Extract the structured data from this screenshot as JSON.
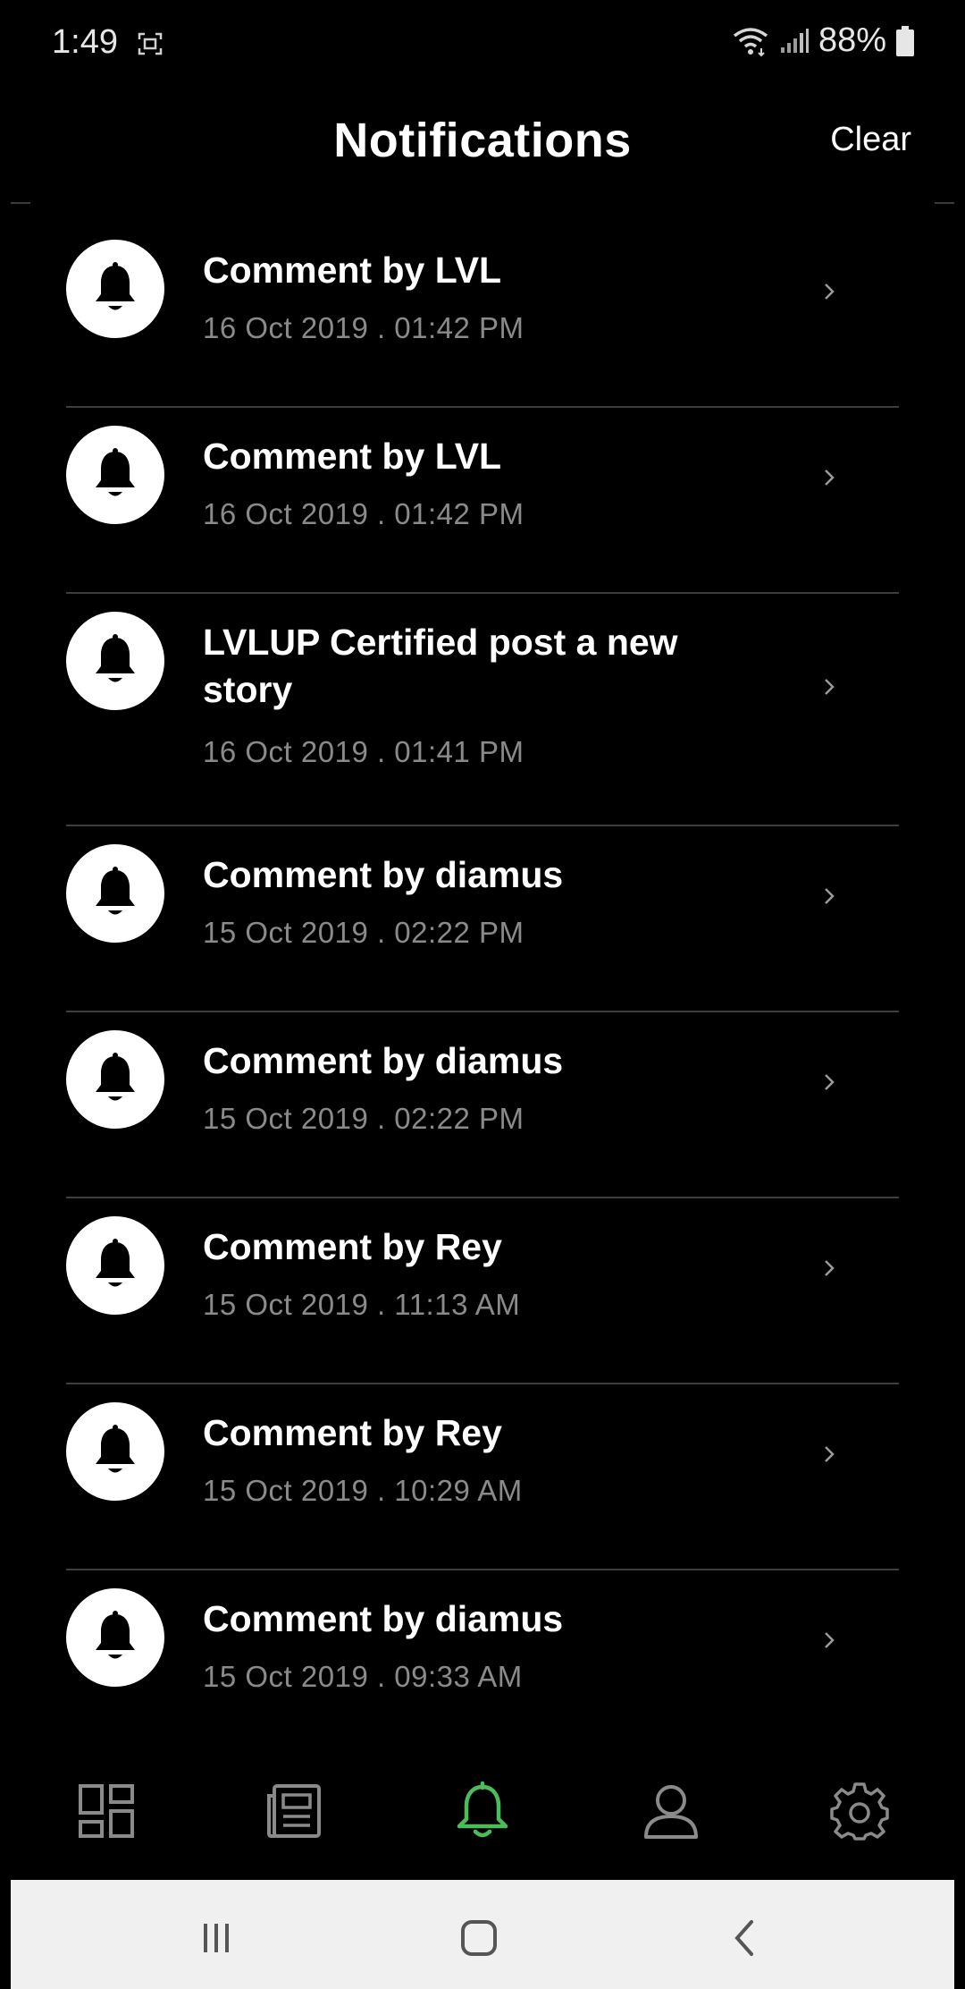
{
  "status_bar": {
    "time": "1:49",
    "battery": "88%",
    "icons": [
      "screenshot-icon",
      "wifi-icon",
      "signal-icon",
      "battery-icon"
    ]
  },
  "header": {
    "title": "Notifications",
    "clear_label": "Clear"
  },
  "notifications": [
    {
      "title": "Comment by LVL",
      "time": "16 Oct 2019 . 01:42 PM",
      "icon": "bell-icon"
    },
    {
      "title": "Comment by LVL",
      "time": "16 Oct 2019 . 01:42 PM",
      "icon": "bell-icon"
    },
    {
      "title": "LVLUP Certified post a new story",
      "time": "16 Oct 2019 . 01:41 PM",
      "icon": "bell-icon"
    },
    {
      "title": "Comment by diamus",
      "time": "15 Oct 2019 . 02:22 PM",
      "icon": "bell-icon"
    },
    {
      "title": "Comment by diamus",
      "time": "15 Oct 2019 . 02:22 PM",
      "icon": "bell-icon"
    },
    {
      "title": "Comment by Rey",
      "time": "15 Oct 2019 . 11:13 AM",
      "icon": "bell-icon"
    },
    {
      "title": "Comment by Rey",
      "time": "15 Oct 2019 . 10:29 AM",
      "icon": "bell-icon"
    },
    {
      "title": "Comment by diamus",
      "time": "15 Oct 2019 . 09:33 AM",
      "icon": "bell-icon"
    }
  ],
  "tab_bar": {
    "tabs": [
      "dashboard-icon",
      "news-icon",
      "notifications-icon",
      "profile-icon",
      "settings-icon"
    ],
    "active": "notifications-icon"
  },
  "system_nav": [
    "recents-icon",
    "home-icon",
    "back-icon"
  ],
  "colors": {
    "background": "#000000",
    "active_tab": "#4cbb5a",
    "inactive_tab": "#8a8a8a",
    "secondary_text": "#8a8a8a",
    "divider": "#3d3d3d",
    "system_nav_bg": "#f0f0f0"
  }
}
